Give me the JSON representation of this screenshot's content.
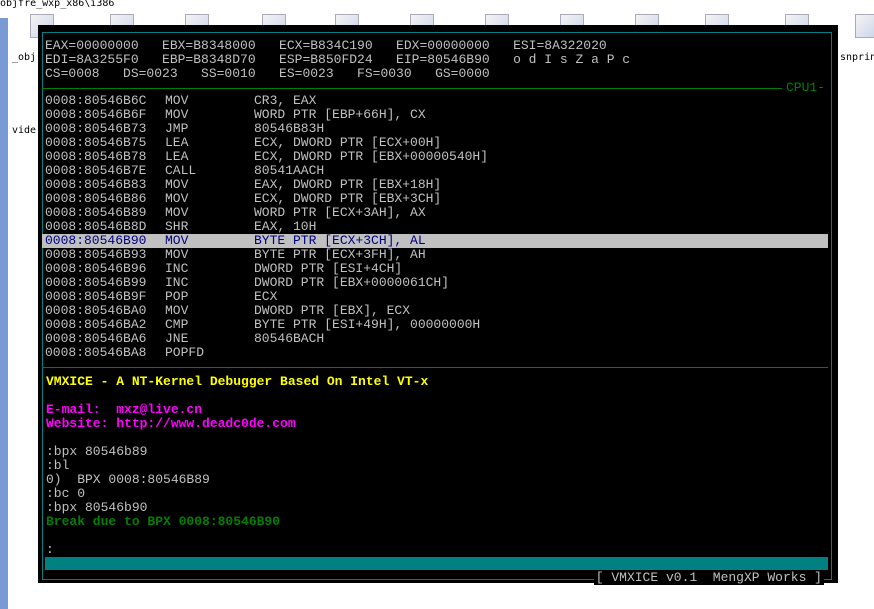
{
  "desktop": {
    "title": "objfre_wxp_x86\\i386",
    "labels": [
      "_obj",
      "vide",
      "snprin"
    ]
  },
  "registers": [
    "EAX=00000000   EBX=B8348000   ECX=B834C190   EDX=00000000   ESI=8A322020",
    "EDI=8A3255F0   EBP=B8348D70   ESP=B850FD24   EIP=80546B90   o d I s Z a P c",
    "CS=0008   DS=0023   SS=0010   ES=0023   FS=0030   GS=0000"
  ],
  "cpu_label": "CPU1-",
  "disasm": [
    {
      "addr": "0008:80546B6C",
      "op": "MOV",
      "args": "CR3, EAX"
    },
    {
      "addr": "0008:80546B6F",
      "op": "MOV",
      "args": "WORD PTR [EBP+66H], CX"
    },
    {
      "addr": "0008:80546B73",
      "op": "JMP",
      "args": "80546B83H"
    },
    {
      "addr": "0008:80546B75",
      "op": "LEA",
      "args": "ECX, DWORD PTR [ECX+00H]"
    },
    {
      "addr": "0008:80546B78",
      "op": "LEA",
      "args": "ECX, DWORD PTR [EBX+00000540H]"
    },
    {
      "addr": "0008:80546B7E",
      "op": "CALL",
      "args": "80541AACH"
    },
    {
      "addr": "0008:80546B83",
      "op": "MOV",
      "args": "EAX, DWORD PTR [EBX+18H]"
    },
    {
      "addr": "0008:80546B86",
      "op": "MOV",
      "args": "ECX, DWORD PTR [EBX+3CH]"
    },
    {
      "addr": "0008:80546B89",
      "op": "MOV",
      "args": "WORD PTR [ECX+3AH], AX"
    },
    {
      "addr": "0008:80546B8D",
      "op": "SHR",
      "args": "EAX, 10H"
    },
    {
      "addr": "0008:80546B90",
      "op": "MOV",
      "args": "BYTE PTR [ECX+3CH], AL",
      "highlighted": true
    },
    {
      "addr": "0008:80546B93",
      "op": "MOV",
      "args": "BYTE PTR [ECX+3FH], AH"
    },
    {
      "addr": "0008:80546B96",
      "op": "INC",
      "args": "DWORD PTR [ESI+4CH]"
    },
    {
      "addr": "0008:80546B99",
      "op": "INC",
      "args": "DWORD PTR [EBX+0000061CH]"
    },
    {
      "addr": "0008:80546B9F",
      "op": "POP",
      "args": "ECX"
    },
    {
      "addr": "0008:80546BA0",
      "op": "MOV",
      "args": "DWORD PTR [EBX], ECX"
    },
    {
      "addr": "0008:80546BA2",
      "op": "CMP",
      "args": "BYTE PTR [ESI+49H], 00000000H"
    },
    {
      "addr": "0008:80546BA6",
      "op": "JNE",
      "args": "80546BACH"
    },
    {
      "addr": "0008:80546BA8",
      "op": "POPFD",
      "args": ""
    }
  ],
  "banner": "VMXICE - A NT-Kernel Debugger Based On Intel VT-x",
  "email": "E-mail:  mxz@live.cn",
  "website": "Website: http://www.deadc0de.com",
  "commands": [
    ":bpx 80546b89",
    ":bl",
    "0)  BPX 0008:80546B89",
    ":bc 0",
    ":bpx 80546b90"
  ],
  "break_msg": "Break due to BPX 0008:80546B90",
  "prompt": ":",
  "status": "[ VMXICE v0.1  MengXP Works ]",
  "colors": {
    "banner": "#ffff00",
    "contact": "#ff00ff",
    "break": "#008000",
    "highlight_bg": "#c0c0c0",
    "highlight_fg": "#000080",
    "accent": "#008080"
  }
}
